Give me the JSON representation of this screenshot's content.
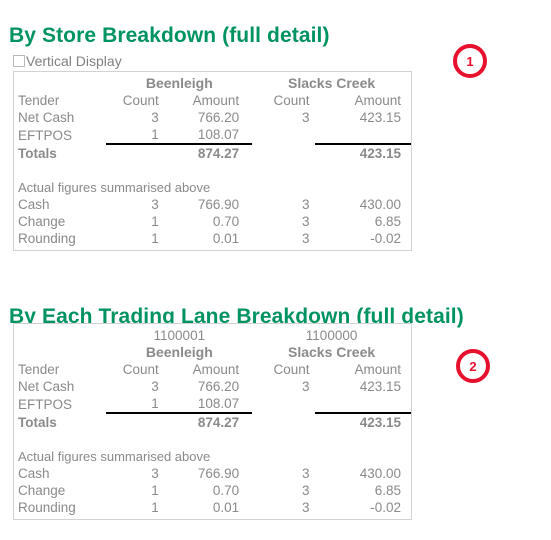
{
  "sections": [
    {
      "heading": "By Store Breakdown (full detail)",
      "vertical_display": {
        "label": "Vertical Display",
        "checked": false
      },
      "table": {
        "has_lane_row": false,
        "lanes": [
          "",
          ""
        ],
        "stores": [
          "Beenleigh",
          "Slacks Creek"
        ],
        "columns": [
          "Tender",
          "Count",
          "Amount",
          "Count",
          "Amount"
        ],
        "rows": [
          {
            "tender": "Net Cash",
            "count1": "3",
            "amount1": "766.20",
            "count2": "3",
            "amount2": "423.15"
          },
          {
            "tender": "EFTPOS",
            "count1": "1",
            "amount1": "108.07",
            "count2": "",
            "amount2": ""
          }
        ],
        "totals": {
          "label": "Totals",
          "amount1": "874.27",
          "amount2": "423.15"
        },
        "note": "Actual figures summarised above",
        "actual_rows": [
          {
            "tender": "Cash",
            "count1": "3",
            "amount1": "766.90",
            "count2": "3",
            "amount2": "430.00"
          },
          {
            "tender": "Change",
            "count1": "1",
            "amount1": "0.70",
            "count2": "3",
            "amount2": "6.85"
          },
          {
            "tender": "Rounding",
            "count1": "1",
            "amount1": "0.01",
            "count2": "3",
            "amount2": "-0.02"
          }
        ]
      },
      "marker": "1"
    },
    {
      "heading": "By Each Trading Lane Breakdown (full detail)",
      "table": {
        "has_lane_row": true,
        "lanes": [
          "1100001",
          "1100000"
        ],
        "stores": [
          "Beenleigh",
          "Slacks Creek"
        ],
        "columns": [
          "Tender",
          "Count",
          "Amount",
          "Count",
          "Amount"
        ],
        "rows": [
          {
            "tender": "Net Cash",
            "count1": "3",
            "amount1": "766.20",
            "count2": "3",
            "amount2": "423.15"
          },
          {
            "tender": "EFTPOS",
            "count1": "1",
            "amount1": "108.07",
            "count2": "",
            "amount2": ""
          }
        ],
        "totals": {
          "label": "Totals",
          "amount1": "874.27",
          "amount2": "423.15"
        },
        "note": "Actual figures summarised above",
        "actual_rows": [
          {
            "tender": "Cash",
            "count1": "3",
            "amount1": "766.90",
            "count2": "3",
            "amount2": "430.00"
          },
          {
            "tender": "Change",
            "count1": "1",
            "amount1": "0.70",
            "count2": "3",
            "amount2": "6.85"
          },
          {
            "tender": "Rounding",
            "count1": "1",
            "amount1": "0.01",
            "count2": "3",
            "amount2": "-0.02"
          }
        ]
      },
      "marker": "2"
    }
  ],
  "colors": {
    "heading": "#009362",
    "body_text": "#8a8a8a",
    "marker": "#e8112d",
    "table_border": "#d2d2d2",
    "rule": "#000000"
  }
}
